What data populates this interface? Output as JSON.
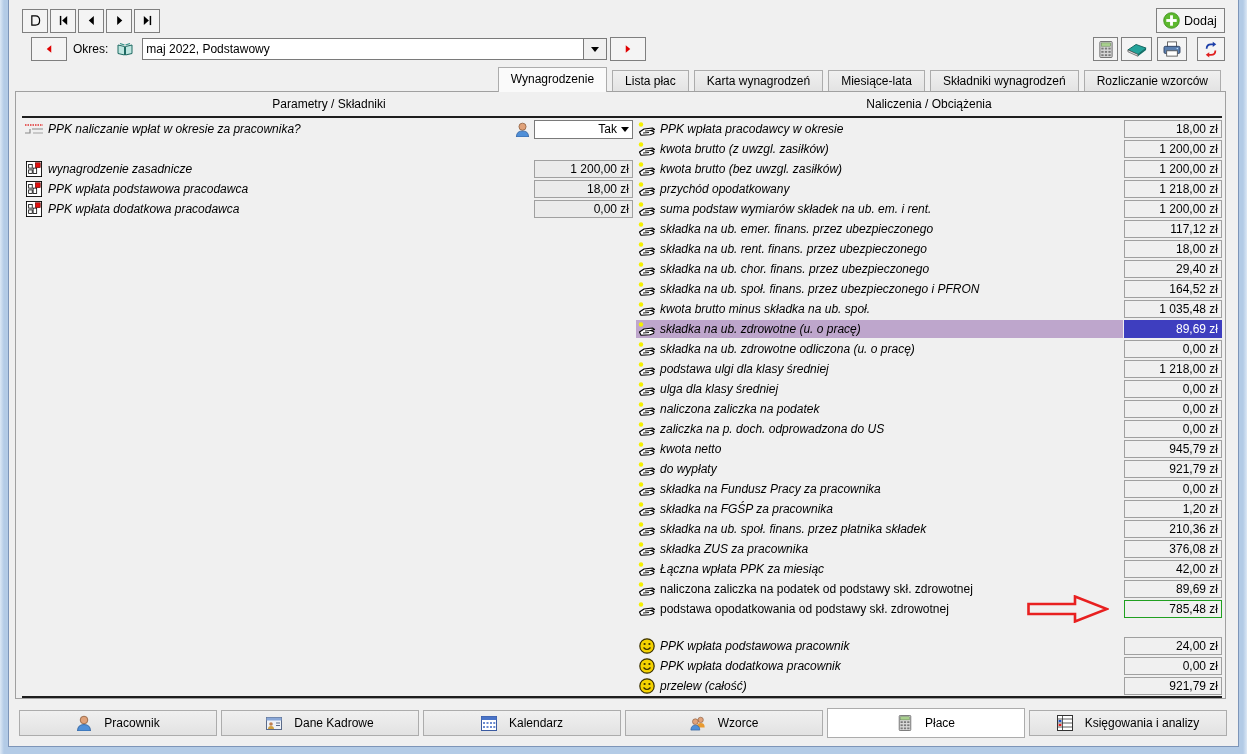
{
  "period": {
    "label": "Okres:",
    "value": "maj 2022, Podstawowy"
  },
  "add_button": {
    "label": "Dodaj"
  },
  "tabs": [
    {
      "label": "Wynagrodzenie",
      "selected": true
    },
    {
      "label": "Lista płac",
      "selected": false
    },
    {
      "label": "Karta wynagrodzeń",
      "selected": false
    },
    {
      "label": "Miesiące-lata",
      "selected": false
    },
    {
      "label": "Składniki wynagrodzeń",
      "selected": false
    },
    {
      "label": "Rozliczanie wzorców",
      "selected": false
    }
  ],
  "left_panel": {
    "header": "Parametry / Składniki",
    "groups": [
      {
        "rows": [
          {
            "kind": "choice",
            "label": "PPK naliczanie wpłat w okresie za pracownika?",
            "value": "Tak"
          }
        ]
      },
      {
        "rows": [
          {
            "kind": "amount",
            "label": "wynagrodzenie zasadnicze",
            "value": "1 200,00 zł"
          },
          {
            "kind": "amount",
            "label": "PPK wpłata podstawowa pracodawca",
            "value": "18,00 zł"
          },
          {
            "kind": "amount",
            "label": "PPK wpłata dodatkowa pracodawca",
            "value": "0,00 zł"
          }
        ]
      }
    ]
  },
  "right_panel": {
    "header": "Naliczenia / Obciążenia",
    "groups": [
      {
        "kind": "accrual",
        "rows": [
          {
            "kind": "standard",
            "label": "PPK wpłata pracodawcy w okresie",
            "value": "18,00 zł",
            "selected": false,
            "focused": false,
            "annotated": false
          },
          {
            "kind": "standard",
            "label": "kwota brutto (z uwzgl. zasiłków)",
            "value": "1 200,00 zł",
            "selected": false,
            "focused": false,
            "annotated": false
          },
          {
            "kind": "standard",
            "label": "kwota brutto (bez uwzgl. zasiłków)",
            "value": "1 200,00 zł",
            "selected": false,
            "focused": false,
            "annotated": false
          },
          {
            "kind": "standard",
            "label": "przychód opodatkowany",
            "value": "1 218,00 zł",
            "selected": false,
            "focused": false,
            "annotated": false
          },
          {
            "kind": "standard",
            "label": "suma podstaw wymiarów składek na ub. em. i rent.",
            "value": "1 200,00 zł",
            "selected": false,
            "focused": false,
            "annotated": false
          },
          {
            "kind": "standard",
            "label": "składka na ub. emer. finans. przez ubezpieczonego",
            "value": "117,12 zł",
            "selected": false,
            "focused": false,
            "annotated": false
          },
          {
            "kind": "standard",
            "label": "składka na ub. rent. finans. przez ubezpieczonego",
            "value": "18,00 zł",
            "selected": false,
            "focused": false,
            "annotated": false
          },
          {
            "kind": "standard",
            "label": "składka na ub. chor. finans. przez ubezpieczonego",
            "value": "29,40 zł",
            "selected": false,
            "focused": false,
            "annotated": false
          },
          {
            "kind": "standard",
            "label": "składka na ub. społ. finans. przez ubezpieczonego i PFRON",
            "value": "164,52 zł",
            "selected": false,
            "focused": false,
            "annotated": false
          },
          {
            "kind": "standard",
            "label": "kwota brutto minus składka na ub. społ.",
            "value": "1 035,48 zł",
            "selected": false,
            "focused": false,
            "annotated": false
          },
          {
            "kind": "standard",
            "label": "składka na ub. zdrowotne (u. o pracę)",
            "value": "89,69 zł",
            "selected": true,
            "focused": false,
            "annotated": false
          },
          {
            "kind": "standard",
            "label": "składka na ub. zdrowotne odliczona (u. o pracę)",
            "value": "0,00 zł",
            "selected": false,
            "focused": false,
            "annotated": false
          },
          {
            "kind": "standard",
            "label": "podstawa ulgi dla klasy średniej",
            "value": "1 218,00 zł",
            "selected": false,
            "focused": false,
            "annotated": false
          },
          {
            "kind": "standard",
            "label": "ulga dla klasy średniej",
            "value": "0,00 zł",
            "selected": false,
            "focused": false,
            "annotated": false
          },
          {
            "kind": "standard",
            "label": "naliczona zaliczka na podatek",
            "value": "0,00 zł",
            "selected": false,
            "focused": false,
            "annotated": false
          },
          {
            "kind": "standard",
            "label": "zaliczka na p. doch. odprowadzona do US",
            "value": "0,00 zł",
            "selected": false,
            "focused": false,
            "annotated": false
          },
          {
            "kind": "standard",
            "label": "kwota netto",
            "value": "945,79 zł",
            "selected": false,
            "focused": false,
            "annotated": false
          },
          {
            "kind": "standard",
            "label": "do wypłaty",
            "value": "921,79 zł",
            "selected": false,
            "focused": false,
            "annotated": false
          },
          {
            "kind": "standard",
            "label": "składka na Fundusz Pracy za pracownika",
            "value": "0,00 zł",
            "selected": false,
            "focused": false,
            "annotated": false
          },
          {
            "kind": "standard",
            "label": "składka na FGŚP za pracownika",
            "value": "1,20 zł",
            "selected": false,
            "focused": false,
            "annotated": false
          },
          {
            "kind": "standard",
            "label": "składka na ub. społ. finans. przez płatnika składek",
            "value": "210,36 zł",
            "selected": false,
            "focused": false,
            "annotated": false
          },
          {
            "kind": "standard",
            "label": "składka ZUS za pracownika",
            "value": "376,08 zł",
            "selected": false,
            "focused": false,
            "annotated": false
          },
          {
            "kind": "standard",
            "label": "Łączna wpłata PPK za miesiąc",
            "value": "42,00 zł",
            "selected": false,
            "focused": false,
            "annotated": false
          },
          {
            "kind": "custom",
            "label": "naliczona zaliczka na podatek od podstawy skł. zdrowotnej",
            "value": "89,69 zł",
            "selected": false,
            "focused": false,
            "annotated": false
          },
          {
            "kind": "custom",
            "label": "podstawa opodatkowania od podstawy skł. zdrowotnej",
            "value": "785,48 zł",
            "selected": false,
            "focused": true,
            "annotated": true
          }
        ]
      },
      {
        "kind": "payout",
        "rows": [
          {
            "kind": "standard",
            "label": "PPK wpłata podstawowa pracownik",
            "value": "24,00 zł",
            "selected": false,
            "focused": false,
            "annotated": false
          },
          {
            "kind": "standard",
            "label": "PPK wpłata dodatkowa pracownik",
            "value": "0,00 zł",
            "selected": false,
            "focused": false,
            "annotated": false
          },
          {
            "kind": "standard",
            "label": "przelew (całość)",
            "value": "921,79 zł",
            "selected": false,
            "focused": false,
            "annotated": false
          }
        ]
      }
    ]
  },
  "bottom_tabs": [
    {
      "label": "Pracownik",
      "selected": false
    },
    {
      "label": "Dane Kadrowe",
      "selected": false
    },
    {
      "label": "Kalendarz",
      "selected": false
    },
    {
      "label": "Wzorce",
      "selected": false
    },
    {
      "label": "Płace",
      "selected": true
    },
    {
      "label": "Księgowania i analizy",
      "selected": false
    }
  ]
}
